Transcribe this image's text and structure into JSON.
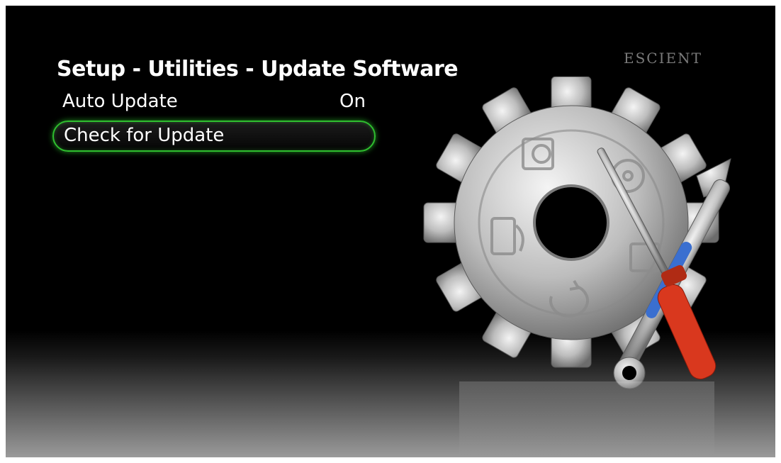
{
  "header": {
    "title": "Setup - Utilities - Update Software",
    "brand": "ESCIENT"
  },
  "menu": {
    "items": [
      {
        "label": "Auto Update",
        "value": "On",
        "selected": false
      },
      {
        "label": "Check for Update",
        "value": "",
        "selected": true
      }
    ]
  },
  "illustration": {
    "icons": [
      "gear-icon",
      "music-disc-icon",
      "film-reel-icon",
      "music-note-icon",
      "photo-icon",
      "refresh-icon",
      "wrench-icon",
      "screwdriver-icon"
    ]
  },
  "colors": {
    "background": "#000000",
    "text": "#ffffff",
    "selection_glow": "#2fbf2f",
    "brand": "#7a7a7a",
    "screwdriver_handle": "#d9381e",
    "wrench_accent": "#3a6fd0"
  }
}
